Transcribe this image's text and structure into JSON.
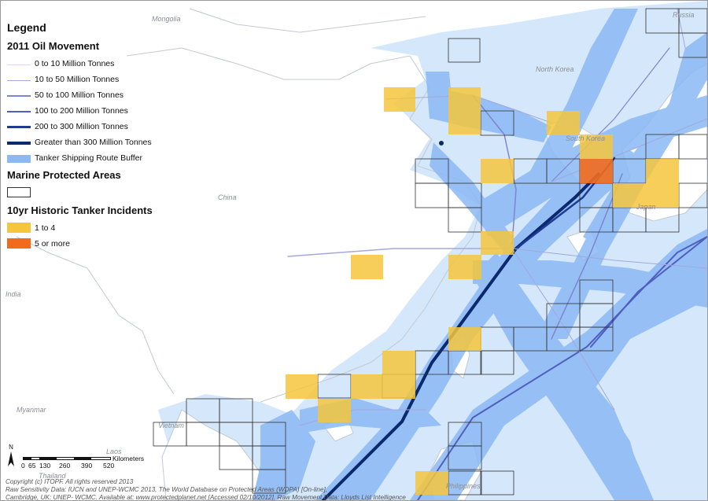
{
  "legend": {
    "title": "Legend",
    "oil_section": "2011 Oil Movement",
    "oil_items": [
      {
        "label": "0 to 10 Million Tonnes",
        "color": "#d7d9f3"
      },
      {
        "label": "10 to 50 Million Tonnes",
        "color": "#a3a8dc"
      },
      {
        "label": "50 to 100 Million Tonnes",
        "color": "#7d85d1"
      },
      {
        "label": "100 to 200 Million Tonnes",
        "color": "#4f5ec0"
      },
      {
        "label": "200 to 300 Million Tonnes",
        "color": "#1f3a94"
      },
      {
        "label": "Greater than 300 Million Tonnes",
        "color": "#0b2a6e"
      },
      {
        "label": "Tanker Shipping Route Buffer",
        "color": "#8ab9f5"
      }
    ],
    "mpa_section": "Marine Protected Areas",
    "incident_section": "10yr Historic Tanker Incidents",
    "incident_items": [
      {
        "label": "1 to 4",
        "color": "#f5c63c"
      },
      {
        "label": "5 or more",
        "color": "#f26b1d"
      }
    ]
  },
  "countries": {
    "mongolia": "Mongolia",
    "russia": "Russia",
    "north_korea": "North Korea",
    "south_korea": "South Korea",
    "china": "China",
    "japan": "Japan",
    "india": "India",
    "myanmar": "Myanmar",
    "vietnam": "Vietnam",
    "laos": "Laos",
    "thailand": "Thailand",
    "philippines": "Philippines"
  },
  "scale": {
    "north": "N",
    "ticks": [
      "0",
      "65",
      "130",
      "260",
      "390",
      "520"
    ],
    "unit": "Kilometers"
  },
  "credits": {
    "line1": "Copyright (c) ITOPF. All rights reserved 2013",
    "line2": "Raw Sensitivity Data: IUCN and UNEP-WCMC 2013, The World Database on Protected Areas (WDPA) [On-line],",
    "line3": "Cambridge, UK: UNEP- WCMC. Available at: www.protectedplanet.net [Accessed 02/10/2012]. Raw Movement Data: Lloyds List Intelligence"
  }
}
